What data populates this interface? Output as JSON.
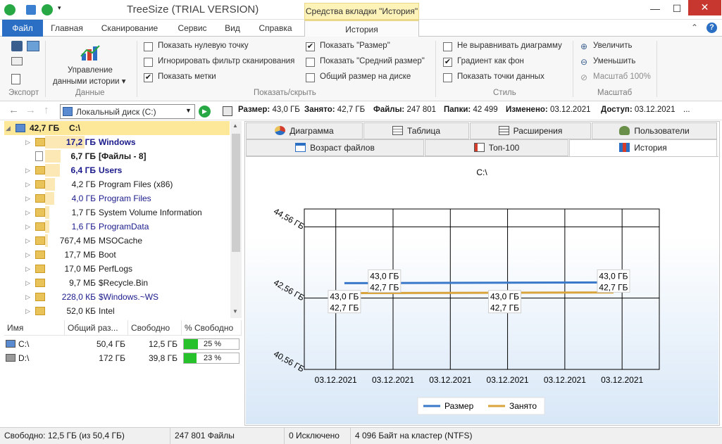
{
  "window": {
    "title": "TreeSize  (TRIAL VERSION)",
    "context_tab": "Средства вкладки \"История\"",
    "minimize": "—",
    "maximize": "☐",
    "close": "✕",
    "help": "?"
  },
  "ribbon_tabs": [
    "Файл",
    "Главная",
    "Сканирование",
    "Сервис",
    "Вид",
    "Справка",
    "История"
  ],
  "ribbon": {
    "export_label": "Экспорт",
    "data_button": "Управление данными истории",
    "data_button_line1": "Управление",
    "data_button_line2": "данными истории ▾",
    "data_label": "Данные",
    "showhide_label": "Показать/скрыть",
    "style_label": "Стиль",
    "scale_label": "Масштаб",
    "showhide": [
      {
        "label": "Показать нулевую точку",
        "checked": false
      },
      {
        "label": "Игнорировать фильтр сканирования",
        "checked": false
      },
      {
        "label": "Показать метки",
        "checked": true
      },
      {
        "label": "Показать \"Размер\"",
        "checked": true
      },
      {
        "label": "Показать \"Средний размер\"",
        "checked": false
      },
      {
        "label": "Общий размер на диске",
        "checked": false
      }
    ],
    "style": [
      {
        "label": "Не выравнивать диаграмму",
        "checked": false
      },
      {
        "label": "Градиент как фон",
        "checked": true
      },
      {
        "label": "Показать точки данных",
        "checked": false
      }
    ],
    "scale": {
      "zoom_in": "Увеличить",
      "zoom_out": "Уменьшить",
      "scale100": "Масштаб 100%"
    }
  },
  "address": {
    "path": "Локальный диск (C:)",
    "size_label": "Размер:",
    "size": "43,0 ГБ",
    "used_label": "Занято:",
    "used": "42,7 ГБ",
    "files_label": "Файлы:",
    "files": "247 801",
    "folders_label": "Папки:",
    "folders": "42 499",
    "modified_label": "Изменено:",
    "modified": "03.12.2021",
    "access_label": "Доступ:",
    "access": "03.12.2021",
    "more": "..."
  },
  "tree": [
    {
      "size": "42,7 ГБ",
      "name": "C:\\",
      "pct": 100,
      "bold": true,
      "color": "#1a1a1a",
      "root": true
    },
    {
      "size": "17,2 ГБ",
      "name": "Windows",
      "pct": 40,
      "bold": true,
      "color": "#1a1a8c"
    },
    {
      "size": "6,7 ГБ",
      "name": "[Файлы - 8]",
      "pct": 16,
      "bold": true,
      "color": "#1a1a1a",
      "file": true
    },
    {
      "size": "6,4 ГБ",
      "name": "Users",
      "pct": 15,
      "bold": true,
      "color": "#1a1a8c"
    },
    {
      "size": "4,2 ГБ",
      "name": "Program Files (x86)",
      "pct": 10,
      "bold": false,
      "color": "#1a1a1a"
    },
    {
      "size": "4,0 ГБ",
      "name": "Program Files",
      "pct": 9,
      "bold": false,
      "color": "#1a1a8c"
    },
    {
      "size": "1,7 ГБ",
      "name": "System Volume Information",
      "pct": 4,
      "bold": false,
      "color": "#1a1a1a"
    },
    {
      "size": "1,6 ГБ",
      "name": "ProgramData",
      "pct": 4,
      "bold": false,
      "color": "#1a1a8c"
    },
    {
      "size": "767,4 МБ",
      "name": "MSOCache",
      "pct": 2,
      "bold": false,
      "color": "#1a1a1a"
    },
    {
      "size": "17,7 МБ",
      "name": "Boot",
      "pct": 0,
      "bold": false,
      "color": "#1a1a1a"
    },
    {
      "size": "17,0 МБ",
      "name": "PerfLogs",
      "pct": 0,
      "bold": false,
      "color": "#1a1a1a"
    },
    {
      "size": "9,7 МБ",
      "name": "$Recycle.Bin",
      "pct": 0,
      "bold": false,
      "color": "#1a1a1a"
    },
    {
      "size": "228,0 КБ",
      "name": "$Windows.~WS",
      "pct": 0,
      "bold": false,
      "color": "#1a1a8c"
    },
    {
      "size": "52,0 КБ",
      "name": "Intel",
      "pct": 0,
      "bold": false,
      "color": "#1a1a1a"
    }
  ],
  "drives": {
    "headers": [
      "Имя",
      "Общий раз...",
      "Свободно",
      "% Свободно"
    ],
    "rows": [
      {
        "name": "C:\\",
        "total": "50,4 ГБ",
        "free": "12,5 ГБ",
        "pct_free": "25 %",
        "pct_value": 25
      },
      {
        "name": "D:\\",
        "total": "172 ГБ",
        "free": "39,8 ГБ",
        "pct_free": "23 %",
        "pct_value": 23
      }
    ]
  },
  "view_tabs_row1": [
    "Диаграмма",
    "Таблица",
    "Расширения",
    "Пользователи"
  ],
  "view_tabs_row2": [
    "Возраст файлов",
    "Топ-100",
    "История"
  ],
  "chart_data": {
    "type": "line",
    "title": "C:\\",
    "x": [
      "03.12.2021",
      "03.12.2021",
      "03.12.2021",
      "03.12.2021",
      "03.12.2021",
      "03.12.2021"
    ],
    "yticks": [
      "44,56 ГБ",
      "42,56 ГБ",
      "40,56 ГБ"
    ],
    "ytick_values": [
      44.56,
      42.56,
      40.56
    ],
    "ylim": [
      40.56,
      45.06
    ],
    "series": [
      {
        "name": "Размер",
        "color": "#3a78c9",
        "x": [
          0.15,
          4.85
        ],
        "values": [
          43.0,
          43.0
        ],
        "labels": [
          "43,0 ГБ",
          "43,0 ГБ"
        ],
        "label_x": [
          0.85,
          4.85
        ]
      },
      {
        "name": "Занято",
        "color": "#d9a43b",
        "x": [
          0.15,
          4.85
        ],
        "values": [
          42.7,
          42.7
        ],
        "labels": [
          "42,7 ГБ",
          "42,7 ГБ"
        ],
        "label_x": [
          0.15,
          2.95
        ]
      }
    ],
    "point_labels": [
      {
        "x": 0.85,
        "lines": [
          "43,0 ГБ",
          "42,7 ГБ"
        ]
      },
      {
        "x": 0.15,
        "lines": [
          "43,0 ГБ",
          "42,7 ГБ"
        ],
        "low": true
      },
      {
        "x": 2.95,
        "lines": [
          "43,0 ГБ",
          "42,7 ГБ"
        ],
        "low": true
      },
      {
        "x": 4.85,
        "lines": [
          "43,0 ГБ",
          "42,7 ГБ"
        ]
      }
    ],
    "grid": true,
    "legend_position": "bottom"
  },
  "status": {
    "free": "Свободно: 12,5 ГБ  (из 50,4 ГБ)",
    "files": "247 801 Файлы",
    "excluded": "0 Исключено",
    "cluster": "4 096 Байт на кластер (NTFS)"
  }
}
